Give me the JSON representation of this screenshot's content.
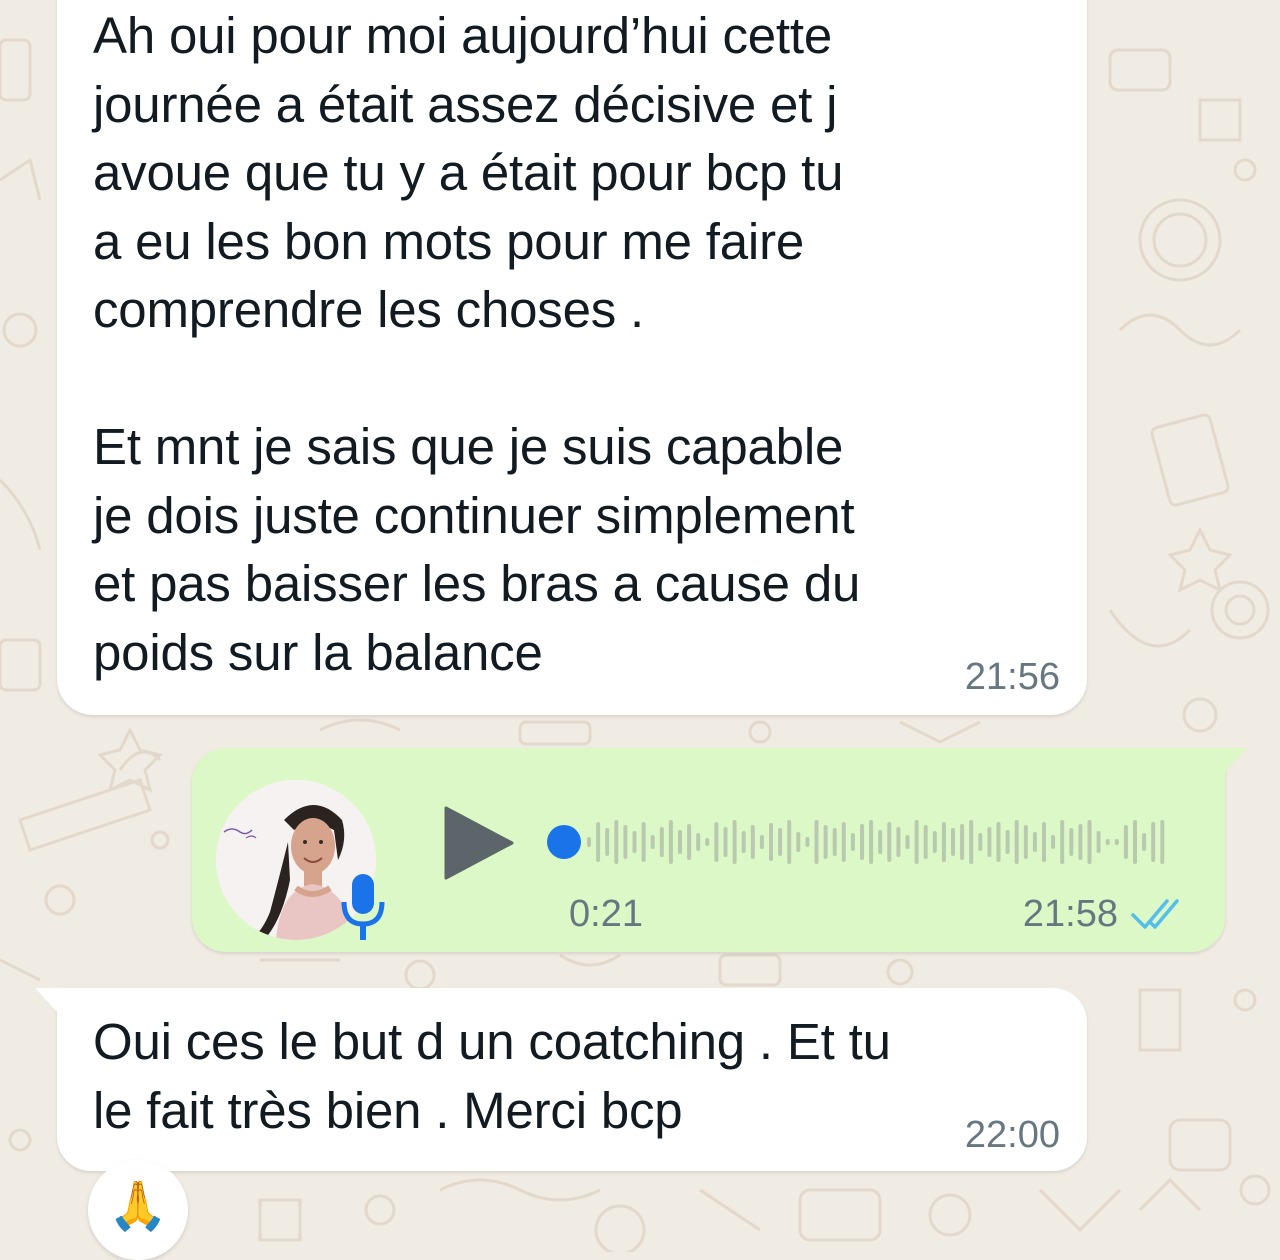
{
  "conversation": {
    "messages": [
      {
        "direction": "incoming",
        "type": "text",
        "text": "Ah oui pour moi aujourd’hui cette\njournée a était assez décisive et j\navoue que tu y a était pour bcp tu\na eu les bon mots pour me faire\ncomprendre les choses .\n\nEt mnt je sais que je suis capable\nje dois juste continuer simplement\net pas baisser les bras a cause du\npoids sur la balance",
        "time": "21:56"
      },
      {
        "direction": "outgoing",
        "type": "voice",
        "avatar_icon": "profile-photo",
        "mic_icon": "microphone-icon",
        "play_icon": "play-icon",
        "duration": "0:21",
        "time": "21:58",
        "status": "read",
        "status_icon": "double-check-icon",
        "playback_progress": 0
      },
      {
        "direction": "incoming",
        "type": "text",
        "text": "Oui ces le but d un coatching . Et tu\nle fait très bien . Merci bcp",
        "time": "22:00",
        "reaction": "🙏"
      }
    ]
  },
  "colors": {
    "wallpaper": "#f0ebe3",
    "incoming_bubble": "#ffffff",
    "outgoing_bubble": "#dcf8c6",
    "accent_blue": "#1a73e8",
    "read_ticks": "#53bdeb",
    "play_button": "#5c6569",
    "waveform": "#b9c9b0"
  }
}
